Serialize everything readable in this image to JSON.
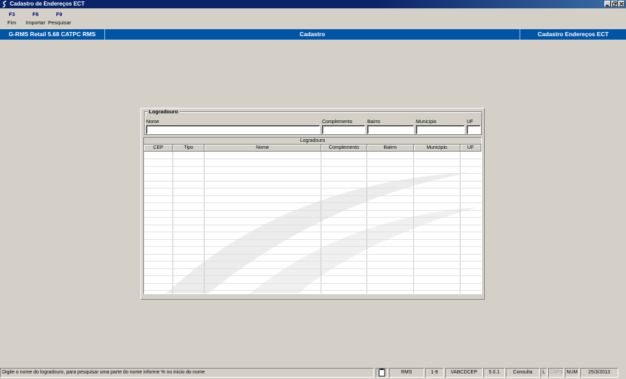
{
  "window": {
    "title": "Cadastro de Endereços ECT",
    "controls": [
      "minimize",
      "restore",
      "close"
    ]
  },
  "function_keys": [
    {
      "key": "F3",
      "label": "Fim"
    },
    {
      "key": "F8",
      "label": "Importar"
    },
    {
      "key": "F9",
      "label": "Pesquisar"
    }
  ],
  "header": {
    "system": "G-RMS Retail 5.68 CATPC RMS",
    "module": "Cadastro",
    "screen": "Cadastro Endereços ECT"
  },
  "search": {
    "group_title": "Logradouro",
    "fields": {
      "nome": {
        "label": "Nome",
        "value": ""
      },
      "complemento": {
        "label": "Complemento",
        "value": ""
      },
      "bairro": {
        "label": "Bairro",
        "value": ""
      },
      "municipio": {
        "label": "Municipio",
        "value": ""
      },
      "uf": {
        "label": "UF",
        "value": ""
      }
    }
  },
  "grid": {
    "caption": "Logradouro",
    "columns": [
      "CEP",
      "Tipo",
      "Nome",
      "Complemento",
      "Bairro",
      "Municipio",
      "UF"
    ],
    "rows": []
  },
  "statusbar": {
    "message": "Digite o nome do logradouro, para pesquisar uma parte do nome informe % no inicio do nome",
    "user": "RMS",
    "range": "1-9",
    "program": "VABCDCEP",
    "version": "5.0.1",
    "mode": "Consulta",
    "l": "L",
    "caps": "CAPS",
    "num": "NUM",
    "date": "25/3/2013"
  },
  "colors": {
    "titlebar": "#0a246a",
    "header_bar": "#0054a6",
    "window_bg": "#d4d0c8",
    "fkey_text": "#000080"
  }
}
